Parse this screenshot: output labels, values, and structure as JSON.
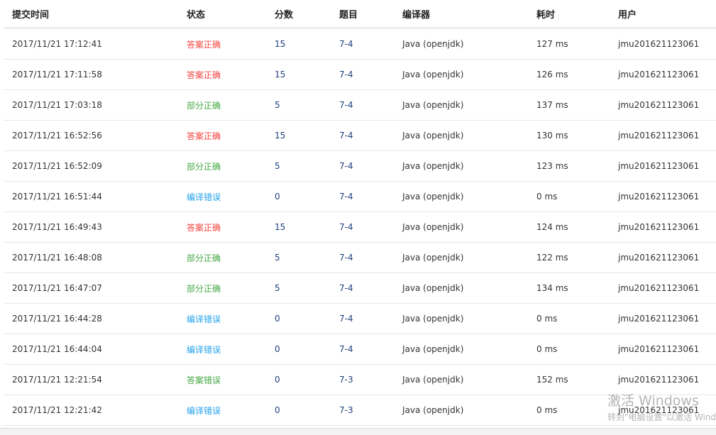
{
  "headers": [
    "提交时间",
    "状态",
    "分数",
    "题目",
    "编译器",
    "耗时",
    "用户"
  ],
  "status_colors": {
    "答案正确": "#f4433f",
    "部分正确": "#45a845",
    "编译错误": "#24a2ec",
    "答案错误": "#45a845"
  },
  "rows": [
    [
      "2017/11/21 17:12:41",
      "答案正确",
      "15",
      "7-4",
      "Java (openjdk)",
      "127 ms",
      "jmu201621123061"
    ],
    [
      "2017/11/21 17:11:58",
      "答案正确",
      "15",
      "7-4",
      "Java (openjdk)",
      "126 ms",
      "jmu201621123061"
    ],
    [
      "2017/11/21 17:03:18",
      "部分正确",
      "5",
      "7-4",
      "Java (openjdk)",
      "137 ms",
      "jmu201621123061"
    ],
    [
      "2017/11/21 16:52:56",
      "答案正确",
      "15",
      "7-4",
      "Java (openjdk)",
      "130 ms",
      "jmu201621123061"
    ],
    [
      "2017/11/21 16:52:09",
      "部分正确",
      "5",
      "7-4",
      "Java (openjdk)",
      "123 ms",
      "jmu201621123061"
    ],
    [
      "2017/11/21 16:51:44",
      "编译错误",
      "0",
      "7-4",
      "Java (openjdk)",
      "0 ms",
      "jmu201621123061"
    ],
    [
      "2017/11/21 16:49:43",
      "答案正确",
      "15",
      "7-4",
      "Java (openjdk)",
      "124 ms",
      "jmu201621123061"
    ],
    [
      "2017/11/21 16:48:08",
      "部分正确",
      "5",
      "7-4",
      "Java (openjdk)",
      "122 ms",
      "jmu201621123061"
    ],
    [
      "2017/11/21 16:47:07",
      "部分正确",
      "5",
      "7-4",
      "Java (openjdk)",
      "134 ms",
      "jmu201621123061"
    ],
    [
      "2017/11/21 16:44:28",
      "编译错误",
      "0",
      "7-4",
      "Java (openjdk)",
      "0 ms",
      "jmu201621123061"
    ],
    [
      "2017/11/21 16:44:04",
      "编译错误",
      "0",
      "7-4",
      "Java (openjdk)",
      "0 ms",
      "jmu201621123061"
    ],
    [
      "2017/11/21 12:21:54",
      "答案错误",
      "0",
      "7-3",
      "Java (openjdk)",
      "152 ms",
      "jmu201621123061"
    ],
    [
      "2017/11/21 12:21:42",
      "编译错误",
      "0",
      "7-3",
      "Java (openjdk)",
      "0 ms",
      "jmu201621123061"
    ]
  ],
  "watermark": {
    "title": "激活 Windows",
    "subtitle": "转到\"电脑设置\"以激活 Windows"
  }
}
